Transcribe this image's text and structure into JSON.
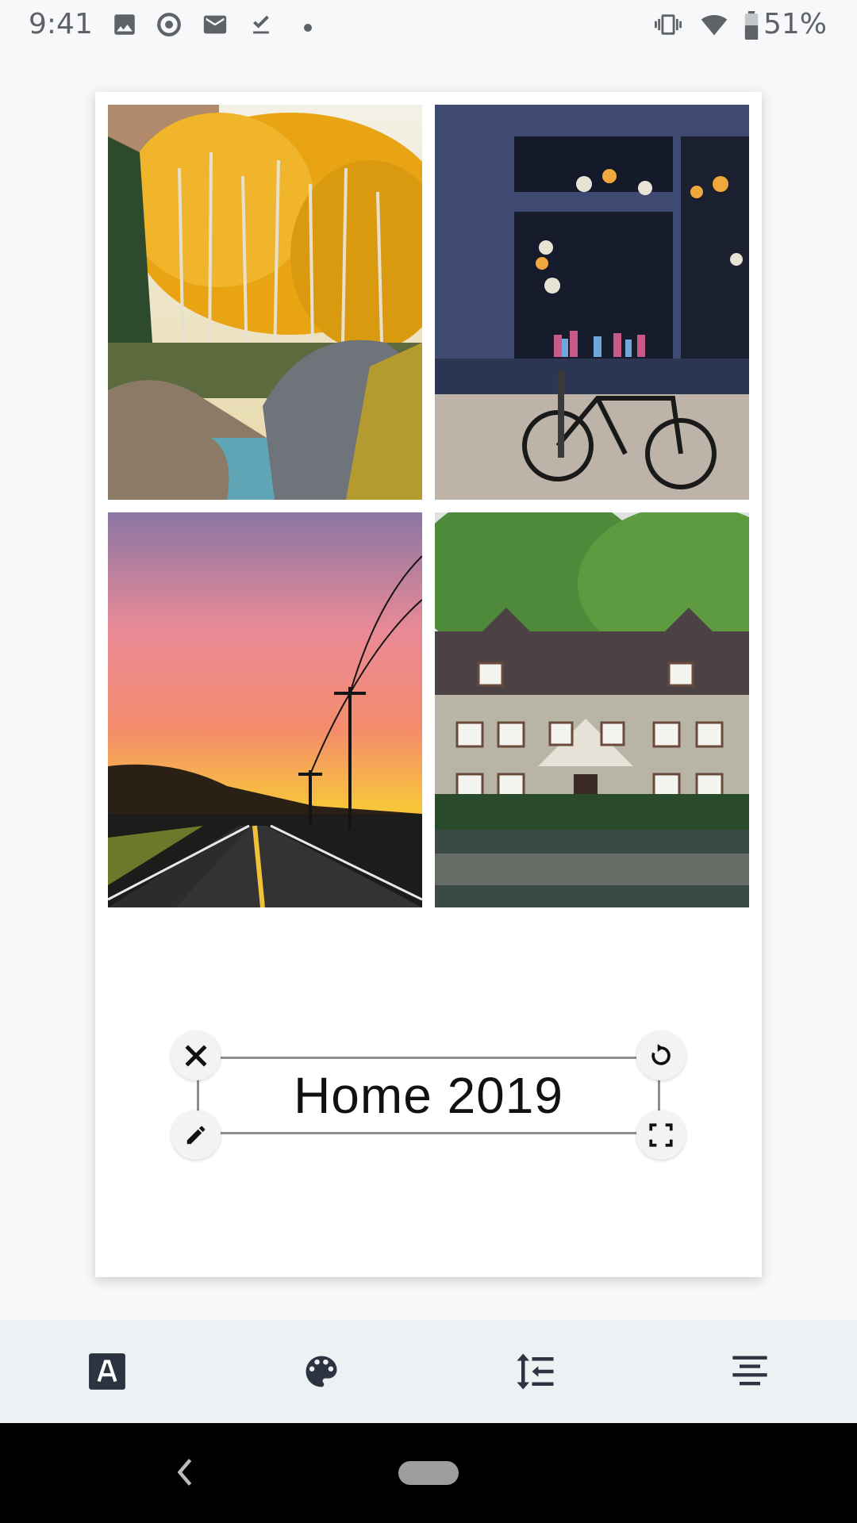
{
  "status_bar": {
    "time": "9:41",
    "battery": "51%",
    "icons": [
      "image-icon",
      "sync-icon",
      "mail-icon",
      "download-done-icon",
      "dot-icon",
      "vibrate-icon",
      "wifi-icon",
      "battery-icon"
    ]
  },
  "canvas": {
    "photos": [
      {
        "name": "autumn-forest-photo"
      },
      {
        "name": "shop-window-bicycle-photo"
      },
      {
        "name": "sunset-road-photo"
      },
      {
        "name": "brick-house-pond-photo"
      }
    ],
    "text_box": {
      "text": "Home 2019"
    }
  },
  "toolbar": {
    "items": [
      "font-icon",
      "palette-icon",
      "line-spacing-icon",
      "align-center-icon"
    ]
  },
  "colors": {
    "toolbar_bg": "#eef1f4",
    "icon": "#2b3440",
    "navbar": "#000000"
  }
}
